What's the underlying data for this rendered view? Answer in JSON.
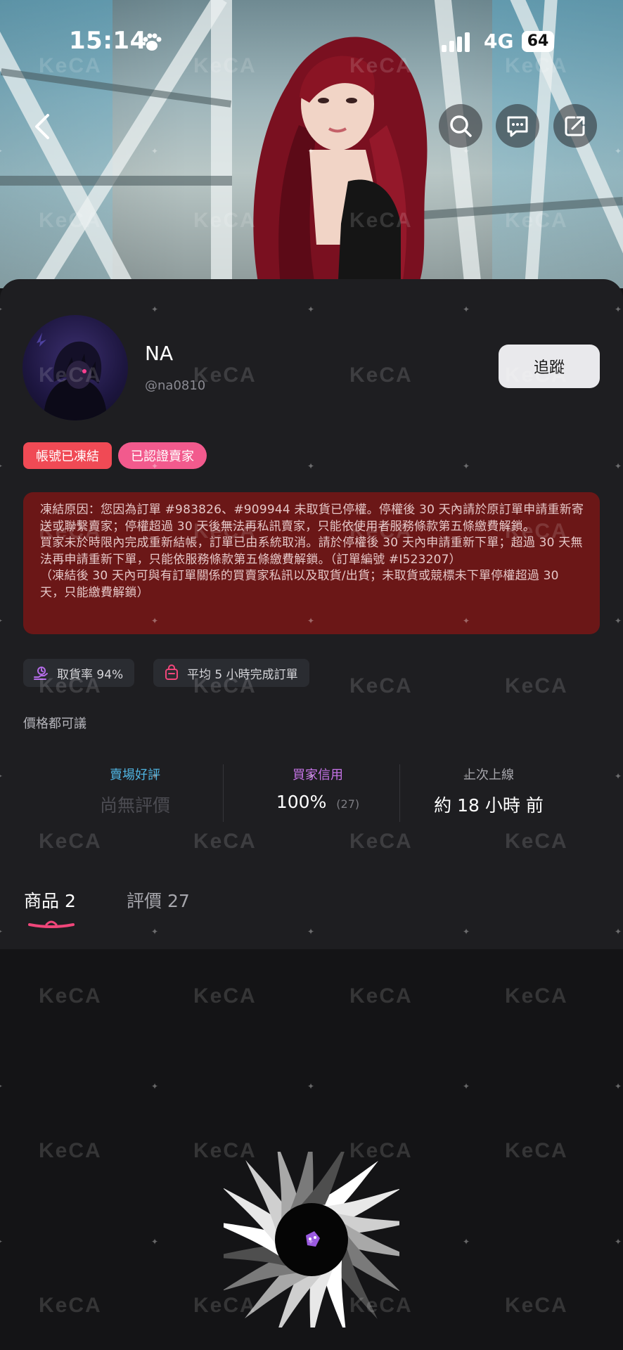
{
  "status_bar": {
    "time": "15:14",
    "network": "4G",
    "battery": "64"
  },
  "profile": {
    "name": "NA",
    "handle": "@na0810",
    "follow_label": "追蹤",
    "badges": {
      "frozen": "帳號已凍結",
      "verified": "已認證賣家"
    },
    "notice": "凍結原因：您因為訂單 #983826、#909944 未取貨已停權。停權後 30 天內請於原訂單申請重新寄送或聯繫賣家；停權超過 30 天後無法再私訊賣家，只能依使用者服務條款第五條繳費解鎖。\n買家未於時限內完成重新結帳，訂單已由系統取消。請於停權後 30 天內申請重新下單；超過 30 天無法再申請重新下單，只能依服務條款第五條繳費解鎖。（訂單編號 #I523207）\n（凍結後 30 天內可與有訂單關係的買賣家私訊以及取貨/出貨；未取貨或競標未下單停權超過 30 天，只能繳費解鎖）",
    "chips": {
      "pickup_rate": "取貨率 94%",
      "avg_complete": "平均 5 小時完成訂單"
    },
    "description": "價格都可議"
  },
  "stats": {
    "seller_rating": {
      "label": "賣場好評",
      "value": "尚無評價"
    },
    "buyer_credit": {
      "label": "買家信用",
      "value": "100%",
      "count": "(27)"
    },
    "last_online": {
      "label": "上次上線",
      "value": "約 18 小時 前"
    }
  },
  "tabs": {
    "products": {
      "label": "商品",
      "count": "2"
    },
    "reviews": {
      "label": "評價",
      "count": "27"
    }
  },
  "watermark_text": "KeCA",
  "colors": {
    "frozen_red": "#f04a55",
    "verified_pink": "#f25a8d",
    "notice_bg": "#6b1717",
    "seller_rating_label": "#4fb3e0",
    "buyer_credit_label": "#c774e8",
    "tab_underline": "#f0467a"
  },
  "icons": {
    "back": "chevron-left-icon",
    "search": "search-icon",
    "chat": "chat-icon",
    "share": "share-icon",
    "pickup": "delivery-icon",
    "order": "bag-icon",
    "paw": "paw-icon"
  }
}
